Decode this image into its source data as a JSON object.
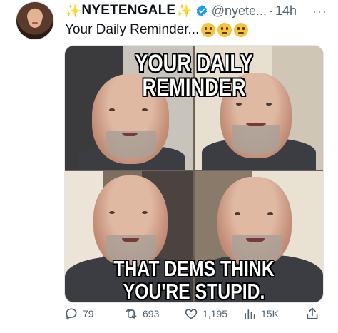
{
  "author": {
    "display_name": "NYETENGALE",
    "sparkle_left": "✨",
    "sparkle_right": "✨",
    "handle": "@nyete...",
    "separator": "·",
    "time": "14h",
    "more": "···"
  },
  "tweet": {
    "text": "Your Daily Reminder...",
    "emojis": [
      "smirk-emoji",
      "thinking-emoji",
      "raised-eyebrow-emoji"
    ]
  },
  "media": {
    "top_caption": "YOUR DAILY REMINDER",
    "bottom_caption_line1": "THAT DEMS THINK",
    "bottom_caption_line2": "YOU'RE STUPID."
  },
  "actions": {
    "replies": "79",
    "reposts": "693",
    "likes": "1,195",
    "views": "15K"
  },
  "colors": {
    "secondary_text": "#536471",
    "verified_blue": "#1d9bf0",
    "sparkle": "#f3c84b"
  }
}
